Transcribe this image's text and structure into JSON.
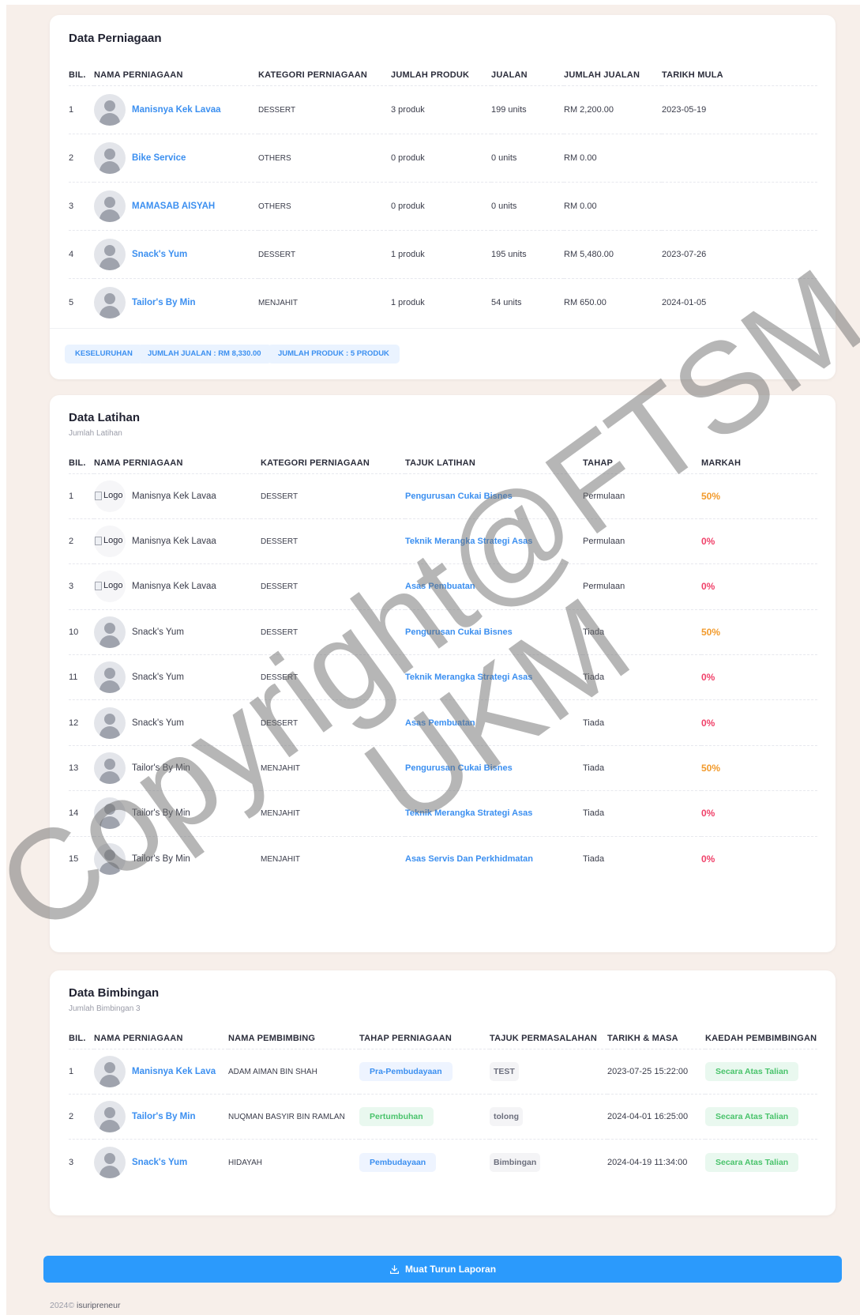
{
  "perniagaan": {
    "title": "Data Perniagaan",
    "headers": [
      "BIL.",
      "NAMA PERNIAGAAN",
      "KATEGORI PERNIAGAAN",
      "JUMLAH PRODUK",
      "JUALAN",
      "JUMLAH JUALAN",
      "TARIKH MULA"
    ],
    "rows": [
      {
        "bil": "1",
        "nama": "Manisnya Kek Lavaa",
        "kategori": "DESSERT",
        "produk": "3 produk",
        "jualan": "199 units",
        "jumlah": "RM 2,200.00",
        "tarikh": "2023-05-19"
      },
      {
        "bil": "2",
        "nama": "Bike Service",
        "kategori": "Others",
        "produk": "0 produk",
        "jualan": "0 units",
        "jumlah": "RM 0.00",
        "tarikh": ""
      },
      {
        "bil": "3",
        "nama": "MAMASAB AISYAH",
        "kategori": "Others",
        "produk": "0 produk",
        "jualan": "0 units",
        "jumlah": "RM 0.00",
        "tarikh": ""
      },
      {
        "bil": "4",
        "nama": "Snack's Yum",
        "kategori": "DESSERT",
        "produk": "1 produk",
        "jualan": "195 units",
        "jumlah": "RM 5,480.00",
        "tarikh": "2023-07-26"
      },
      {
        "bil": "5",
        "nama": "Tailor's By Min",
        "kategori": "MENJAHIT",
        "produk": "1 produk",
        "jualan": "54 units",
        "jumlah": "RM 650.00",
        "tarikh": "2024-01-05"
      }
    ],
    "summary": {
      "keseluruhan": "KESELURUHAN",
      "jumlah_jualan": "JUMLAH JUALAN : RM 8,330.00",
      "jumlah_produk": "JUMLAH PRODUK : 5 PRODUK"
    }
  },
  "latihan": {
    "title": "Data Latihan",
    "subtitle": "Jumlah Latihan",
    "headers": [
      "BIL.",
      "NAMA PERNIAGAAN",
      "KATEGORI PERNIAGAAN",
      "TAJUK LATIHAN",
      "TAHAP",
      "MARKAH"
    ],
    "logo_alt": "Logo",
    "rows": [
      {
        "bil": "1",
        "img": "logo",
        "nama": "Manisnya Kek Lavaa",
        "kategori": "DESSERT",
        "tajuk": "Pengurusan Cukai Bisnes",
        "tahap": "Permulaan",
        "markah": "50%",
        "color": "#f29a2b"
      },
      {
        "bil": "2",
        "img": "logo",
        "nama": "Manisnya Kek Lavaa",
        "kategori": "DESSERT",
        "tajuk": "Teknik Merangka Strategi Asas",
        "tahap": "Permulaan",
        "markah": "0%",
        "color": "#f0426a"
      },
      {
        "bil": "3",
        "img": "logo",
        "nama": "Manisnya Kek Lavaa",
        "kategori": "DESSERT",
        "tajuk": "Asas Pembuatan",
        "tahap": "Permulaan",
        "markah": "0%",
        "color": "#f0426a"
      },
      {
        "bil": "10",
        "img": "avatar",
        "nama": "Snack's Yum",
        "kategori": "DESSERT",
        "tajuk": "Pengurusan Cukai Bisnes",
        "tahap": "Tiada",
        "markah": "50%",
        "color": "#f29a2b"
      },
      {
        "bil": "11",
        "img": "avatar",
        "nama": "Snack's Yum",
        "kategori": "DESSERT",
        "tajuk": "Teknik Merangka Strategi Asas",
        "tahap": "Tiada",
        "markah": "0%",
        "color": "#f0426a"
      },
      {
        "bil": "12",
        "img": "avatar",
        "nama": "Snack's Yum",
        "kategori": "DESSERT",
        "tajuk": "Asas Pembuatan",
        "tahap": "Tiada",
        "markah": "0%",
        "color": "#f0426a"
      },
      {
        "bil": "13",
        "img": "avatar",
        "nama": "Tailor's By Min",
        "kategori": "MENJAHIT",
        "tajuk": "Pengurusan Cukai Bisnes",
        "tahap": "Tiada",
        "markah": "50%",
        "color": "#f29a2b"
      },
      {
        "bil": "14",
        "img": "avatar",
        "nama": "Tailor's By Min",
        "kategori": "MENJAHIT",
        "tajuk": "Teknik Merangka Strategi Asas",
        "tahap": "Tiada",
        "markah": "0%",
        "color": "#f0426a"
      },
      {
        "bil": "15",
        "img": "avatar",
        "nama": "Tailor's By Min",
        "kategori": "MENJAHIT",
        "tajuk": "Asas Servis Dan Perkhidmatan",
        "tahap": "Tiada",
        "markah": "0%",
        "color": "#f0426a"
      }
    ]
  },
  "bimbingan": {
    "title": "Data Bimbingan",
    "subtitle": "Jumlah Bimbingan 3",
    "headers": [
      "BIL.",
      "NAMA PERNIAGAAN",
      "NAMA PEMBIMBING",
      "TAHAP PERNIAGAAN",
      "TAJUK PERMASALAHAN",
      "TARIKH & MASA",
      "KAEDAH PEMBIMBINGAN"
    ],
    "rows": [
      {
        "bil": "1",
        "nama": "Manisnya Kek Lava",
        "pembimbing": "ADAM AIMAN BIN SHAH",
        "tahap": "Pra-Pembudayaan",
        "tahap_style": "blue",
        "tajuk": "TEST",
        "tarikh": "2023-07-25 15:22:00",
        "kaedah": "Secara Atas Talian"
      },
      {
        "bil": "2",
        "nama": "Tailor's By Min",
        "pembimbing": "NUQMAN BASYIR BIN RAMLAN",
        "tahap": "Pertumbuhan",
        "tahap_style": "green",
        "tajuk": "tolong",
        "tarikh": "2024-04-01 16:25:00",
        "kaedah": "Secara Atas Talian"
      },
      {
        "bil": "3",
        "nama": "Snack's Yum",
        "pembimbing": "HIDAYAH",
        "tahap": "Pembudayaan",
        "tahap_style": "blue",
        "tajuk": "Bimbingan",
        "tarikh": "2024-04-19 11:34:00",
        "kaedah": "Secara Atas Talian"
      }
    ]
  },
  "download": {
    "label": "Muat Turun Laporan",
    "icon": "download-icon",
    "color": "#2b9afc"
  },
  "footer": {
    "year": "2024©",
    "brand": "isuripreneur"
  },
  "watermark": {
    "line1": "Copyright@FTSM",
    "line2": "UKM"
  },
  "colors": {
    "link": "#3b8ff0",
    "orange": "#f29a2b",
    "red": "#f0426a",
    "green": "#49c36b",
    "page_bg": "#f7efea"
  }
}
